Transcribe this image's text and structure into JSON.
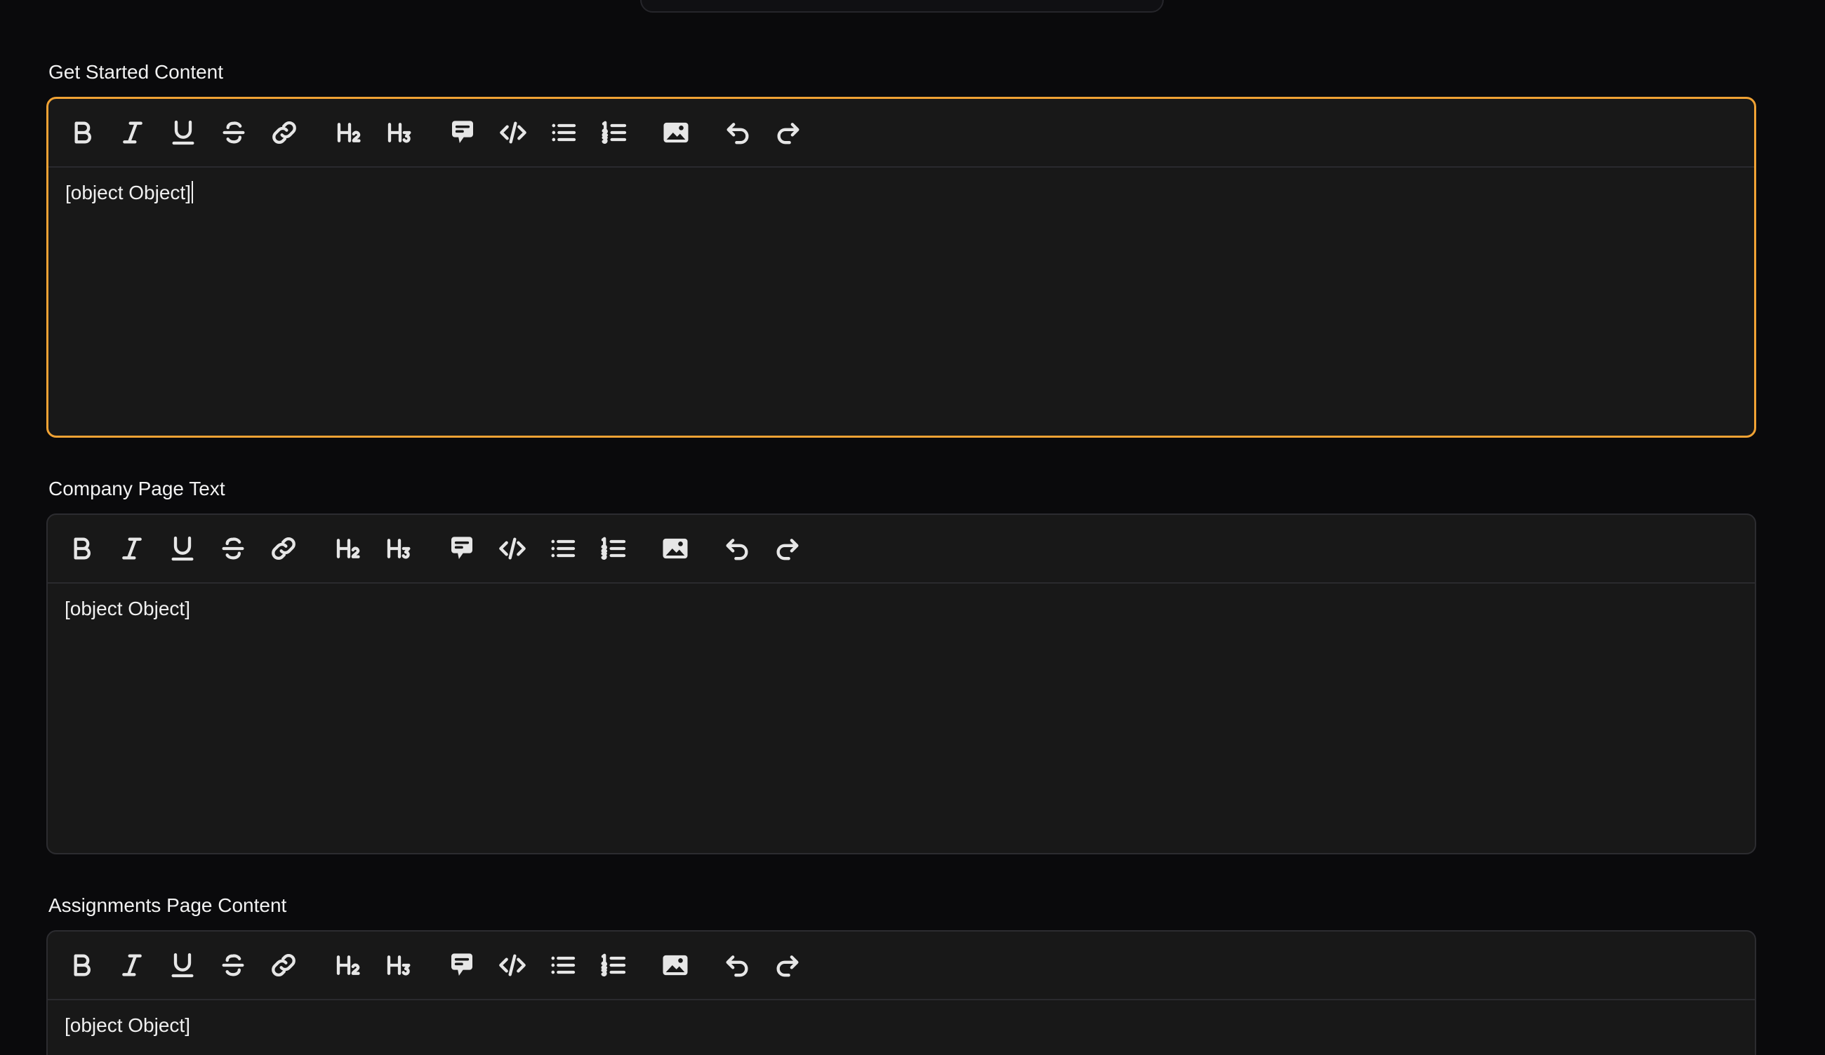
{
  "fields": [
    {
      "label": "Get Started Content",
      "content": "[object Object]",
      "focused": true
    },
    {
      "label": "Company Page Text",
      "content": "[object Object]",
      "focused": false
    },
    {
      "label": "Assignments Page Content",
      "content": "[object Object]",
      "focused": false
    }
  ],
  "toolbar": {
    "buttons": [
      {
        "name": "bold-icon"
      },
      {
        "name": "italic-icon"
      },
      {
        "name": "underline-icon"
      },
      {
        "name": "strikethrough-icon"
      },
      {
        "name": "link-icon"
      },
      {
        "name": "heading-2-icon"
      },
      {
        "name": "heading-3-icon"
      },
      {
        "name": "blockquote-icon"
      },
      {
        "name": "code-icon"
      },
      {
        "name": "bullet-list-icon"
      },
      {
        "name": "ordered-list-icon"
      },
      {
        "name": "image-icon"
      },
      {
        "name": "undo-icon"
      },
      {
        "name": "redo-icon"
      }
    ]
  },
  "colors": {
    "focus_border": "#f0a234",
    "editor_bg": "#181818",
    "page_bg": "#0a0a0c"
  }
}
